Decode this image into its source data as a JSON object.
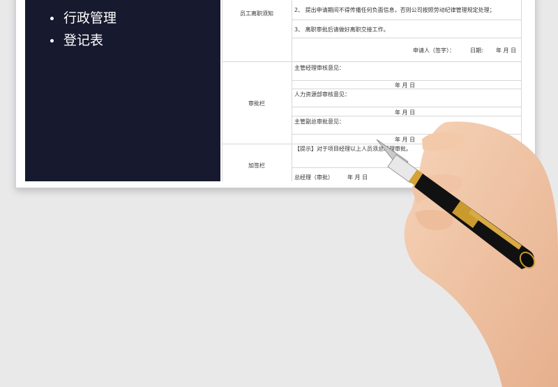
{
  "slide": {
    "bullets": [
      "行政管理",
      "登记表"
    ]
  },
  "form": {
    "section_notice_label": "员工离职须知",
    "notice_line_2": "2、 提出申请期间不得传播任何负面信息，否则公司按照劳动纪律管理规定处理；",
    "notice_line_3": "3、 离职审批后请做好离职交接工作。",
    "applicant_label": "申请人（签字）：",
    "date_label": "日期:",
    "date_placeholder": "年  月  日",
    "section_approval_label": "审批栏",
    "manager_opinion": "主管经理审核意见：",
    "manager_date": "年  月  日",
    "hr_opinion": "人力资源部审核意见：",
    "hr_date": "年  月  日",
    "vp_opinion": "主管副总审批意见：",
    "vp_date": "年  月  日",
    "section_extra_label": "加签栏",
    "tip_text": "【提示】对于项目经理以上人员须总经理审批。",
    "gm_label": "总经理（审批）",
    "gm_date": "年  月  日"
  },
  "colors": {
    "panel": "#171a2e",
    "background": "#e9e9ea"
  },
  "icons": [
    "fountain-pen-icon",
    "hand-image"
  ]
}
